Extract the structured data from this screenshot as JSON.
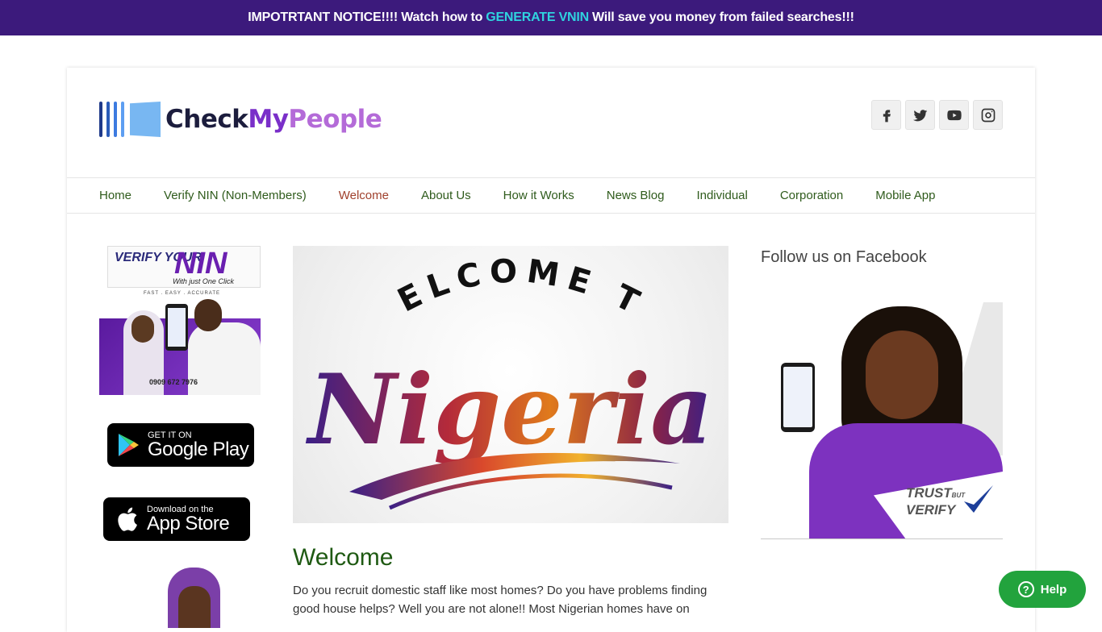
{
  "notice": {
    "prefix": "IMPOTRTANT NOTICE!!!! Watch how to",
    "highlight": "GENERATE VNIN",
    "suffix": "Will save you money from failed searches!!!"
  },
  "logo": {
    "check": "Check",
    "my": "My",
    "people": "People"
  },
  "social": [
    "facebook-icon",
    "twitter-icon",
    "youtube-icon",
    "instagram-icon"
  ],
  "nav": {
    "items": [
      {
        "label": "Home"
      },
      {
        "label": "Verify NIN (Non-Members)"
      },
      {
        "label": "Welcome"
      },
      {
        "label": "About Us"
      },
      {
        "label": "How it Works"
      },
      {
        "label": "News Blog"
      },
      {
        "label": "Individual"
      },
      {
        "label": "Corporation"
      },
      {
        "label": "Mobile App"
      }
    ],
    "active": "Welcome"
  },
  "promo": {
    "verify": "VERIFY YOUR",
    "nin": "NIN",
    "oneclick": "With just One Click",
    "features": "FAST . EASY . ACCURATE",
    "phone": "0909 672 7976"
  },
  "stores": {
    "google_small": "GET IT ON",
    "google_big": "Google Play",
    "apple_small": "Download on the",
    "apple_big": "App Store"
  },
  "hero": {
    "line1": "WELCOME TO",
    "line2": "Nigeria"
  },
  "main": {
    "title": "Welcome",
    "body": "Do you recruit domestic staff like most homes? Do you have problems finding good house helps? Well you are not alone!! Most Nigerian homes have on"
  },
  "sidebar_right": {
    "title": "Follow us on Facebook",
    "trust": "TRUST",
    "but": "BUT",
    "verify": "VERIFY"
  },
  "help": {
    "label": "Help"
  }
}
